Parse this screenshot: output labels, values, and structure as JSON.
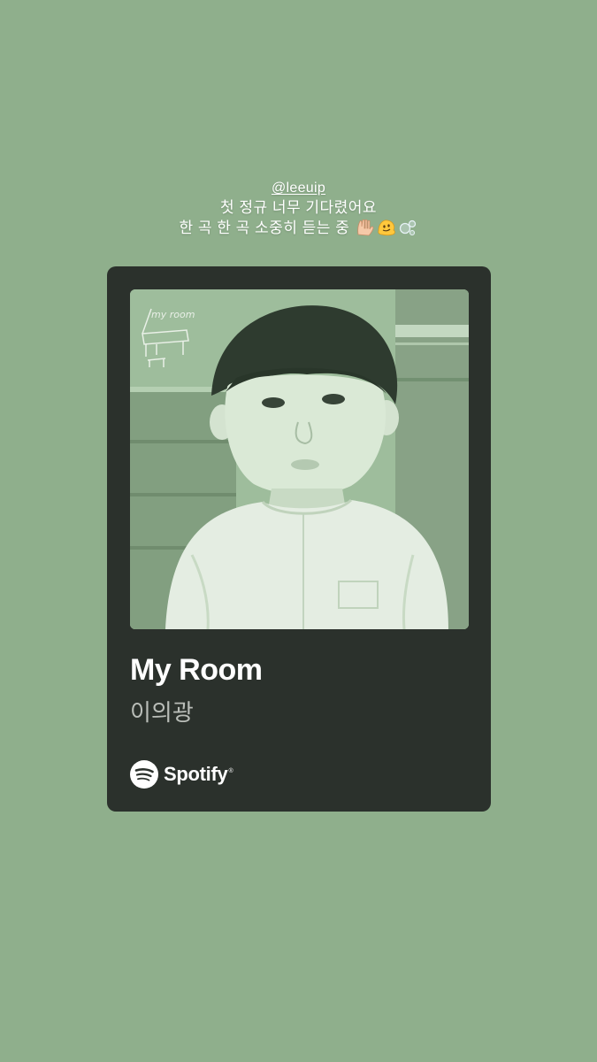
{
  "caption": {
    "mention": "@leeuip",
    "line1": "첫 정규 너무 기다렸어요",
    "line2": "한 곡 한 곡 소중히 듣는 중",
    "emojis": [
      "raised-hands-icon",
      "melting-face-icon",
      "bubbles-icon"
    ]
  },
  "cover": {
    "handwriting": "my room"
  },
  "track": {
    "title": "My Room",
    "artist": "이의광"
  },
  "brand": {
    "name": "Spotify",
    "mark": "®"
  },
  "colors": {
    "background": "#8faf8c",
    "card": "#2b312c",
    "cover_tint": "#a3c2a0",
    "title": "#ffffff",
    "artist": "#b9bdb8"
  }
}
